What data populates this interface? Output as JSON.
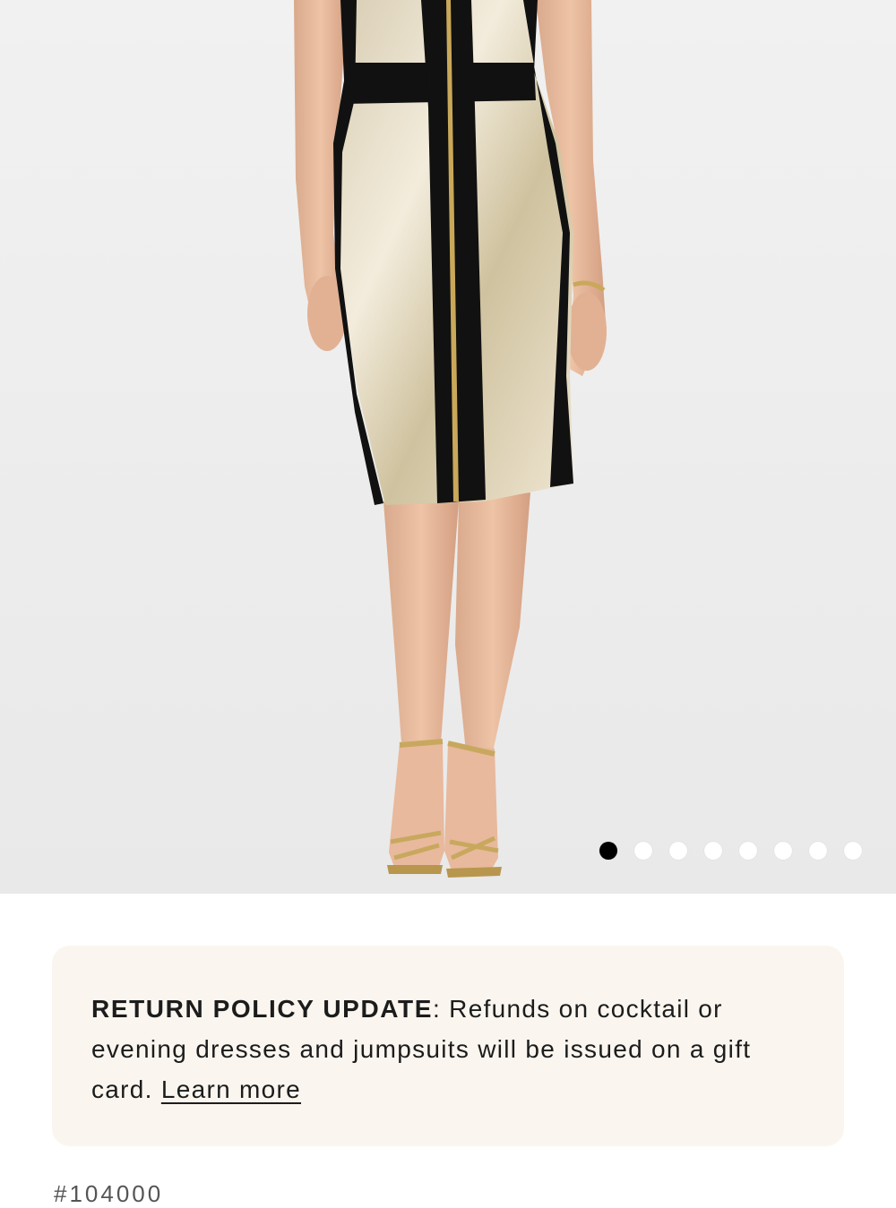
{
  "gallery": {
    "image_alt": "Metallic gold and black color-block sheath dress",
    "dot_count": 8,
    "active_index": 0
  },
  "notice": {
    "title": "RETURN POLICY UPDATE",
    "separator": ":",
    "body": " Refunds on cocktail or evening dresses and jumpsuits will be issued on a gift card. ",
    "link_label": "Learn more"
  },
  "product": {
    "sku_partial": "#104000"
  },
  "colors": {
    "notice_bg": "#faf6ef",
    "dot_active": "#000000",
    "dot_inactive": "#ffffff"
  }
}
